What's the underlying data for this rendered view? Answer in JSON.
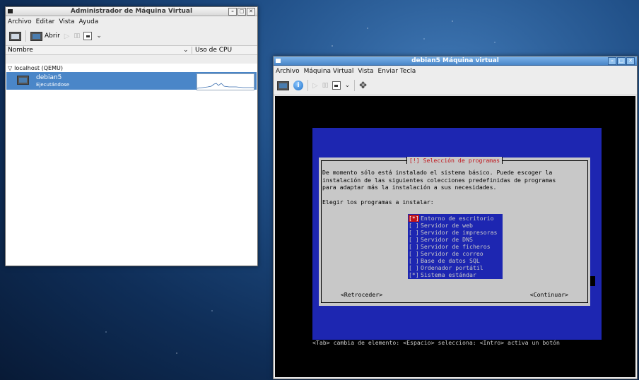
{
  "manager": {
    "title": "Administrador de Máquina Virtual",
    "menu": [
      "Archivo",
      "Editar",
      "Vista",
      "Ayuda"
    ],
    "toolbar": {
      "open_label": "Abrir"
    },
    "columns": {
      "name": "Nombre",
      "cpu": "Uso de CPU"
    },
    "group": "localhost (QEMU)",
    "vm": {
      "name": "debian5",
      "status": "Ejecutándose"
    }
  },
  "viewer": {
    "title": "debian5 Máquina virtual",
    "menu": [
      "Archivo",
      "Máquina Virtual",
      "Vista",
      "Enviar Tecla"
    ]
  },
  "installer": {
    "dialog_title": "[!] Selección de programas",
    "description": [
      "De momento sólo está instalado el sistema básico. Puede escoger la",
      "instalación de las siguientes colecciones predefinidas de programas",
      "para adaptar más la instalación a sus necesidades."
    ],
    "prompt": "Elegir los programas a instalar:",
    "options": [
      {
        "mark": "[*]",
        "label": "Entorno de escritorio",
        "selected": true
      },
      {
        "mark": "[ ]",
        "label": "Servidor de web",
        "selected": false
      },
      {
        "mark": "[ ]",
        "label": "Servidor de impresoras",
        "selected": false
      },
      {
        "mark": "[ ]",
        "label": "Servidor de DNS",
        "selected": false
      },
      {
        "mark": "[ ]",
        "label": "Servidor de ficheros",
        "selected": false
      },
      {
        "mark": "[ ]",
        "label": "Servidor de correo",
        "selected": false
      },
      {
        "mark": "[ ]",
        "label": "Base de datos SQL",
        "selected": false
      },
      {
        "mark": "[ ]",
        "label": "Ordenador portátil",
        "selected": false
      },
      {
        "mark": "[*]",
        "label": "Sistema estándar",
        "selected": false
      }
    ],
    "back_button": "<Retroceder>",
    "continue_button": "<Continuar>",
    "status_line": "<Tab> cambia de elemento: <Espacio> selecciona: <Intro> activa un botón"
  },
  "colors": {
    "installer_blue": "#1d26b1",
    "dialog_grey": "#c8c8c8",
    "highlight_red": "#c0141a",
    "selection_blue": "#4a86c8"
  }
}
